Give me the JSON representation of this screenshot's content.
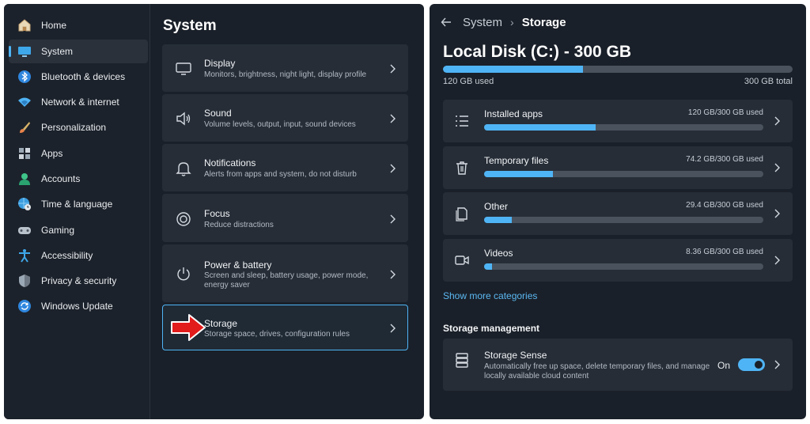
{
  "sidebar": {
    "items": [
      {
        "label": "Home",
        "icon": "home-icon"
      },
      {
        "label": "System",
        "icon": "monitor-icon",
        "selected": true
      },
      {
        "label": "Bluetooth & devices",
        "icon": "bluetooth-icon"
      },
      {
        "label": "Network & internet",
        "icon": "wifi-icon"
      },
      {
        "label": "Personalization",
        "icon": "brush-icon"
      },
      {
        "label": "Apps",
        "icon": "apps-icon"
      },
      {
        "label": "Accounts",
        "icon": "person-icon"
      },
      {
        "label": "Time & language",
        "icon": "globe-clock-icon"
      },
      {
        "label": "Gaming",
        "icon": "gamepad-icon"
      },
      {
        "label": "Accessibility",
        "icon": "accessibility-icon"
      },
      {
        "label": "Privacy & security",
        "icon": "shield-icon"
      },
      {
        "label": "Windows Update",
        "icon": "update-icon"
      }
    ]
  },
  "system": {
    "title": "System",
    "cards": [
      {
        "title": "Display",
        "desc": "Monitors, brightness, night light, display profile",
        "icon": "display-icon"
      },
      {
        "title": "Sound",
        "desc": "Volume levels, output, input, sound devices",
        "icon": "speaker-icon"
      },
      {
        "title": "Notifications",
        "desc": "Alerts from apps and system, do not disturb",
        "icon": "bell-icon"
      },
      {
        "title": "Focus",
        "desc": "Reduce distractions",
        "icon": "focus-icon"
      },
      {
        "title": "Power & battery",
        "desc": "Screen and sleep, battery usage, power mode, energy saver",
        "icon": "power-icon"
      },
      {
        "title": "Storage",
        "desc": "Storage space, drives, configuration rules",
        "icon": "arrow-pointer-icon",
        "selected": true
      }
    ]
  },
  "storage": {
    "breadcrumb": [
      "System",
      "Storage"
    ],
    "disk_title": "Local Disk (C:) - 300 GB",
    "used_label": "120 GB used",
    "total_label": "300 GB total",
    "used_fraction": 0.4,
    "categories": [
      {
        "name": "Installed apps",
        "size": "120 GB/300 GB used",
        "fraction": 0.4,
        "icon": "list-icon"
      },
      {
        "name": "Temporary files",
        "size": "74.2 GB/300 GB used",
        "fraction": 0.247,
        "icon": "trash-icon"
      },
      {
        "name": "Other",
        "size": "29.4 GB/300 GB used",
        "fraction": 0.098,
        "icon": "file-icon"
      },
      {
        "name": "Videos",
        "size": "8.36 GB/300 GB used",
        "fraction": 0.028,
        "icon": "video-icon"
      }
    ],
    "show_more": "Show more categories",
    "management_header": "Storage management",
    "sense": {
      "title": "Storage Sense",
      "desc": "Automatically free up space, delete temporary files, and manage locally available cloud content",
      "state": "On"
    }
  },
  "colors": {
    "accent": "#4fb4f5",
    "background": "#1a2029",
    "card": "#262d37",
    "arrow": "#e21b1b"
  }
}
